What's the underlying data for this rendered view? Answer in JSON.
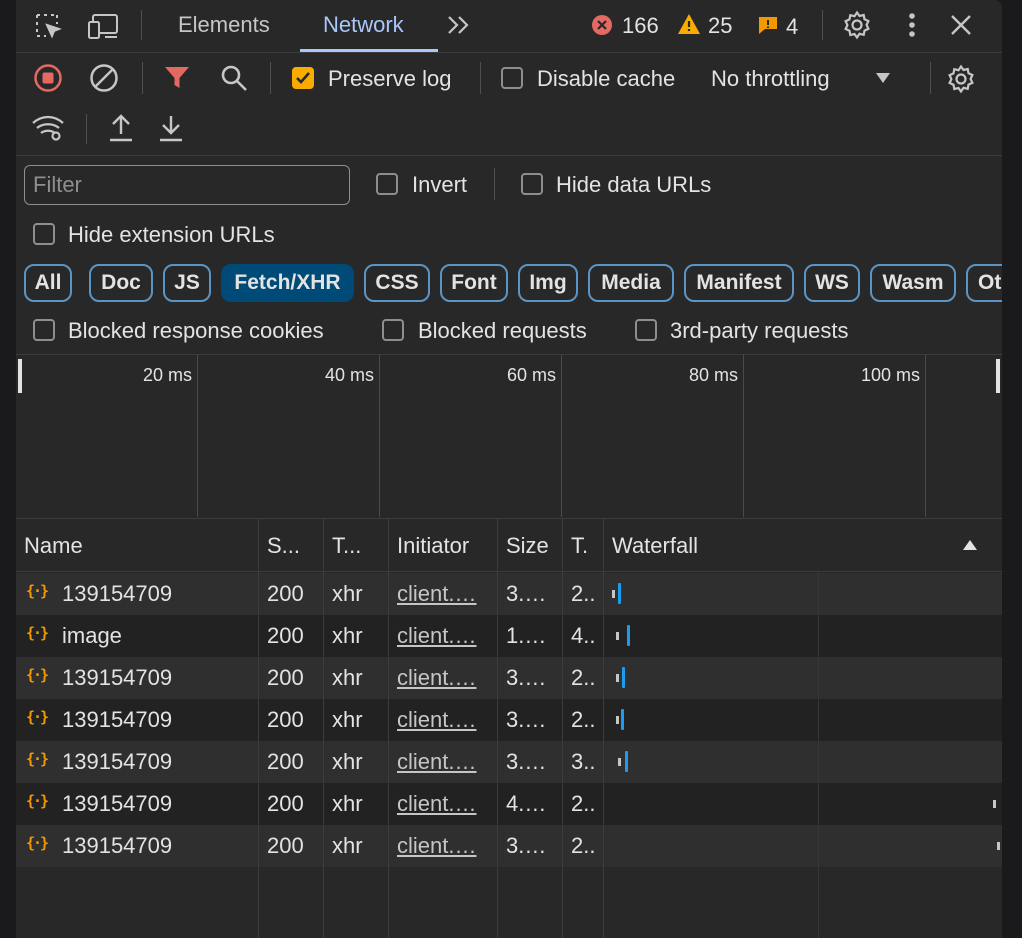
{
  "tabs": {
    "elements": "Elements",
    "network": "Network",
    "more": "»"
  },
  "status": {
    "errors": "166",
    "warnings": "25",
    "issues": "4"
  },
  "toolbar": {
    "preserve_log": "Preserve log",
    "preserve_log_checked": true,
    "disable_cache": "Disable cache",
    "throttling": "No throttling"
  },
  "filter": {
    "placeholder": "Filter",
    "invert": "Invert",
    "hide_data_urls": "Hide data URLs",
    "hide_extension_urls": "Hide extension URLs"
  },
  "type_filters": [
    "All",
    "Doc",
    "JS",
    "Fetch/XHR",
    "CSS",
    "Font",
    "Img",
    "Media",
    "Manifest",
    "WS",
    "Wasm",
    "Oth"
  ],
  "active_type_filter": "Fetch/XHR",
  "more_filters": {
    "blocked_cookies": "Blocked response cookies",
    "blocked_requests": "Blocked requests",
    "third_party": "3rd-party requests"
  },
  "overview_ticks": [
    "20 ms",
    "40 ms",
    "60 ms",
    "80 ms",
    "100 ms"
  ],
  "columns": {
    "name": "Name",
    "status": "S...",
    "type": "T...",
    "initiator": "Initiator",
    "size": "Size",
    "time": "T.",
    "waterfall": "Waterfall",
    "sort_icon": "sort-ascending-icon"
  },
  "requests": [
    {
      "name": "139154709",
      "status": "200",
      "type": "xhr",
      "initiator": "client.…",
      "size": "3.…",
      "time": "2.."
    },
    {
      "name": "image",
      "status": "200",
      "type": "xhr",
      "initiator": "client.…",
      "size": "1.…",
      "time": "4.."
    },
    {
      "name": "139154709",
      "status": "200",
      "type": "xhr",
      "initiator": "client.…",
      "size": "3.…",
      "time": "2.."
    },
    {
      "name": "139154709",
      "status": "200",
      "type": "xhr",
      "initiator": "client.…",
      "size": "3.…",
      "time": "2.."
    },
    {
      "name": "139154709",
      "status": "200",
      "type": "xhr",
      "initiator": "client.…",
      "size": "3.…",
      "time": "3.."
    },
    {
      "name": "139154709",
      "status": "200",
      "type": "xhr",
      "initiator": "client.…",
      "size": "4.…",
      "time": "2.."
    },
    {
      "name": "139154709",
      "status": "200",
      "type": "xhr",
      "initiator": "client.…",
      "size": "3.…",
      "time": "2.."
    }
  ],
  "colors": {
    "accent": "#a8c7fa",
    "error": "#e46962",
    "warning": "#f9ab00",
    "xhr": "#f29900",
    "bar": "#1a9cf0"
  }
}
